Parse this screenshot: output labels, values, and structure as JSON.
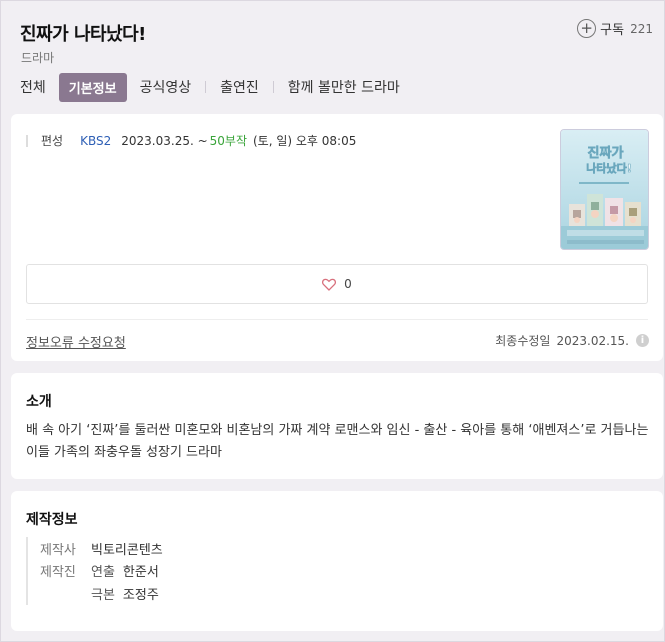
{
  "header": {
    "title": "진짜가 나타났다!",
    "genre": "드라마",
    "subscribe_label": "구독",
    "subscribe_count": "221"
  },
  "tabs": [
    {
      "label": "전체",
      "active": false
    },
    {
      "label": "기본정보",
      "active": true
    },
    {
      "label": "공식영상",
      "active": false
    },
    {
      "label": "출연진",
      "active": false
    },
    {
      "label": "함께 볼만한 드라마",
      "active": false
    }
  ],
  "broadcast": {
    "label": "편성",
    "channel": "KBS2",
    "date_range": "2023.03.25. ~",
    "episodes": "50부작",
    "schedule": "(토, 일) 오후 08:05"
  },
  "poster": {
    "title_line1": "진짜가",
    "title_line2": "나타났다!"
  },
  "like": {
    "count": "0"
  },
  "footer": {
    "error_link": "정보오류 수정요청",
    "updated_label": "최종수정일",
    "updated_date": "2023.02.15."
  },
  "intro": {
    "title": "소개",
    "text": "배 속 아기 ‘진짜’를 둘러싼 미혼모와 비혼남의 가짜 계약 로맨스와 임신 - 출산 - 육아를 통해 ‘애벤져스’로 거듭나는 이들 가족의 좌충우돌 성장기 드라마"
  },
  "production": {
    "title": "제작정보",
    "company_label": "제작사",
    "company": "빅토리콘텐츠",
    "crew_label": "제작진",
    "director_role": "연출",
    "director": "한준서",
    "writer_role": "극본",
    "writer": "조정주"
  },
  "colors": {
    "accent": "#8a7890",
    "channel": "#2e5fb5",
    "episodes": "#3aa43a",
    "background": "#f1eff3"
  }
}
